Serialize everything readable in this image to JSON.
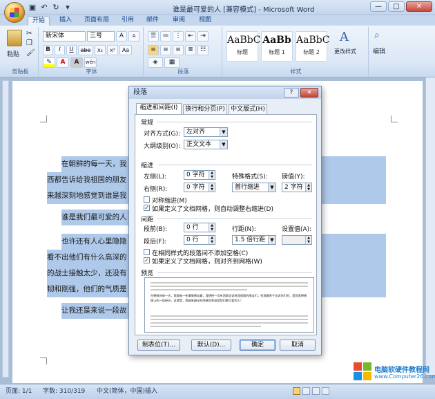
{
  "window": {
    "title": "谁是最可爱的人 [兼容模式] - Microsoft Word",
    "minimize": "—",
    "maximize": "□",
    "close": "✕"
  },
  "ribbon": {
    "tabs": [
      "开始",
      "插入",
      "页面布局",
      "引用",
      "邮件",
      "审阅",
      "视图"
    ],
    "clipboard": {
      "label": "剪贴板",
      "paste": "粘贴"
    },
    "font": {
      "label": "字体",
      "name": "新宋体",
      "size": "三号",
      "bold": "B",
      "italic": "I",
      "underline": "U",
      "strike": "abe",
      "sub": "x₂",
      "sup": "x²",
      "clear": "Aa",
      "color_a": "A",
      "grow": "A",
      "shrink": "A",
      "phonetic": "wén",
      "box": "A"
    },
    "paragraph": {
      "label": "段落"
    },
    "styles": {
      "label": "样式",
      "items": [
        {
          "sample": "AaBbC",
          "name": "标题"
        },
        {
          "sample": "AaBb",
          "name": "标题 1"
        },
        {
          "sample": "AaBbC",
          "name": "标题 2"
        }
      ],
      "change": "更改样式"
    },
    "editing": {
      "label": "编辑"
    }
  },
  "document": {
    "paragraphs": [
      "在朝鲜的每一天，我                                              着；我想把一切东",
      "西都告诉给我祖国的朋友                                          历，这就是，我越",
      "来越深刻地感觉到谁是我",
      "谁是我们最可爱的人",
      "也许还有人心里隐隐                                              、很简单的哩，既",
      "看不出他们有什么高深的                                          这是由于他跟我们",
      "的战士接触太少，还没有                                          的意志是那样的坚",
      "韧和刚强，他们的气质是                                          。",
      "让我还是来说一段故"
    ]
  },
  "dialog": {
    "title": "段落",
    "help": "?",
    "close": "✕",
    "tabs": [
      "缩进和间距(I)",
      "换行和分页(P)",
      "中文版式(H)"
    ],
    "general": {
      "heading": "常规",
      "align_label": "对齐方式(G):",
      "align_value": "左对齐",
      "outline_label": "大纲级别(O):",
      "outline_value": "正文文本"
    },
    "indent": {
      "heading": "缩进",
      "left_label": "左侧(L):",
      "left_value": "0 字符",
      "right_label": "右侧(R):",
      "right_value": "0 字符",
      "special_label": "特殊格式(S):",
      "special_value": "首行缩进",
      "by_label": "磅值(Y):",
      "by_value": "2 字符",
      "mirror_label": "对称缩进(M)",
      "auto_label": "如果定义了文档网格，则自动调整右缩进(D)"
    },
    "spacing": {
      "heading": "间距",
      "before_label": "段前(B):",
      "before_value": "0 行",
      "after_label": "段后(F):",
      "after_value": "0 行",
      "line_label": "行距(N):",
      "line_value": "1.5 倍行距",
      "at_label": "设置值(A):",
      "at_value": "",
      "no_space_label": "在相同样式的段落间不添加空格(C)",
      "grid_label": "如果定义了文档网格，则对齐到网格(W)"
    },
    "preview": {
      "heading": "预览",
      "sample_text": "在朝鲜的每一天，我都被一些事情感动着；我想把一切东西都告诉给我祖国的朋友们。但我最急于告诉你们的，是我思想感情上的一段经历，这就是，我越来越深刻地感觉到谁是我们最可爱的人！"
    },
    "buttons": {
      "tabs": "制表位(T)...",
      "default": "默认(D)...",
      "ok": "确定",
      "cancel": "取消"
    },
    "checks": {
      "mirror": "",
      "auto": "✓",
      "no_space": "",
      "grid": "✓"
    }
  },
  "status": {
    "page": "页面: 1/1",
    "words": "字数: 310/319",
    "language": "中文(简体，中国)",
    "mode": "插入"
  },
  "watermark": {
    "line1": "电脑软硬件教程网",
    "line2": "www.Computer26.com"
  },
  "colors": {
    "accent": "#15428b",
    "selection": "#aec9ea"
  }
}
